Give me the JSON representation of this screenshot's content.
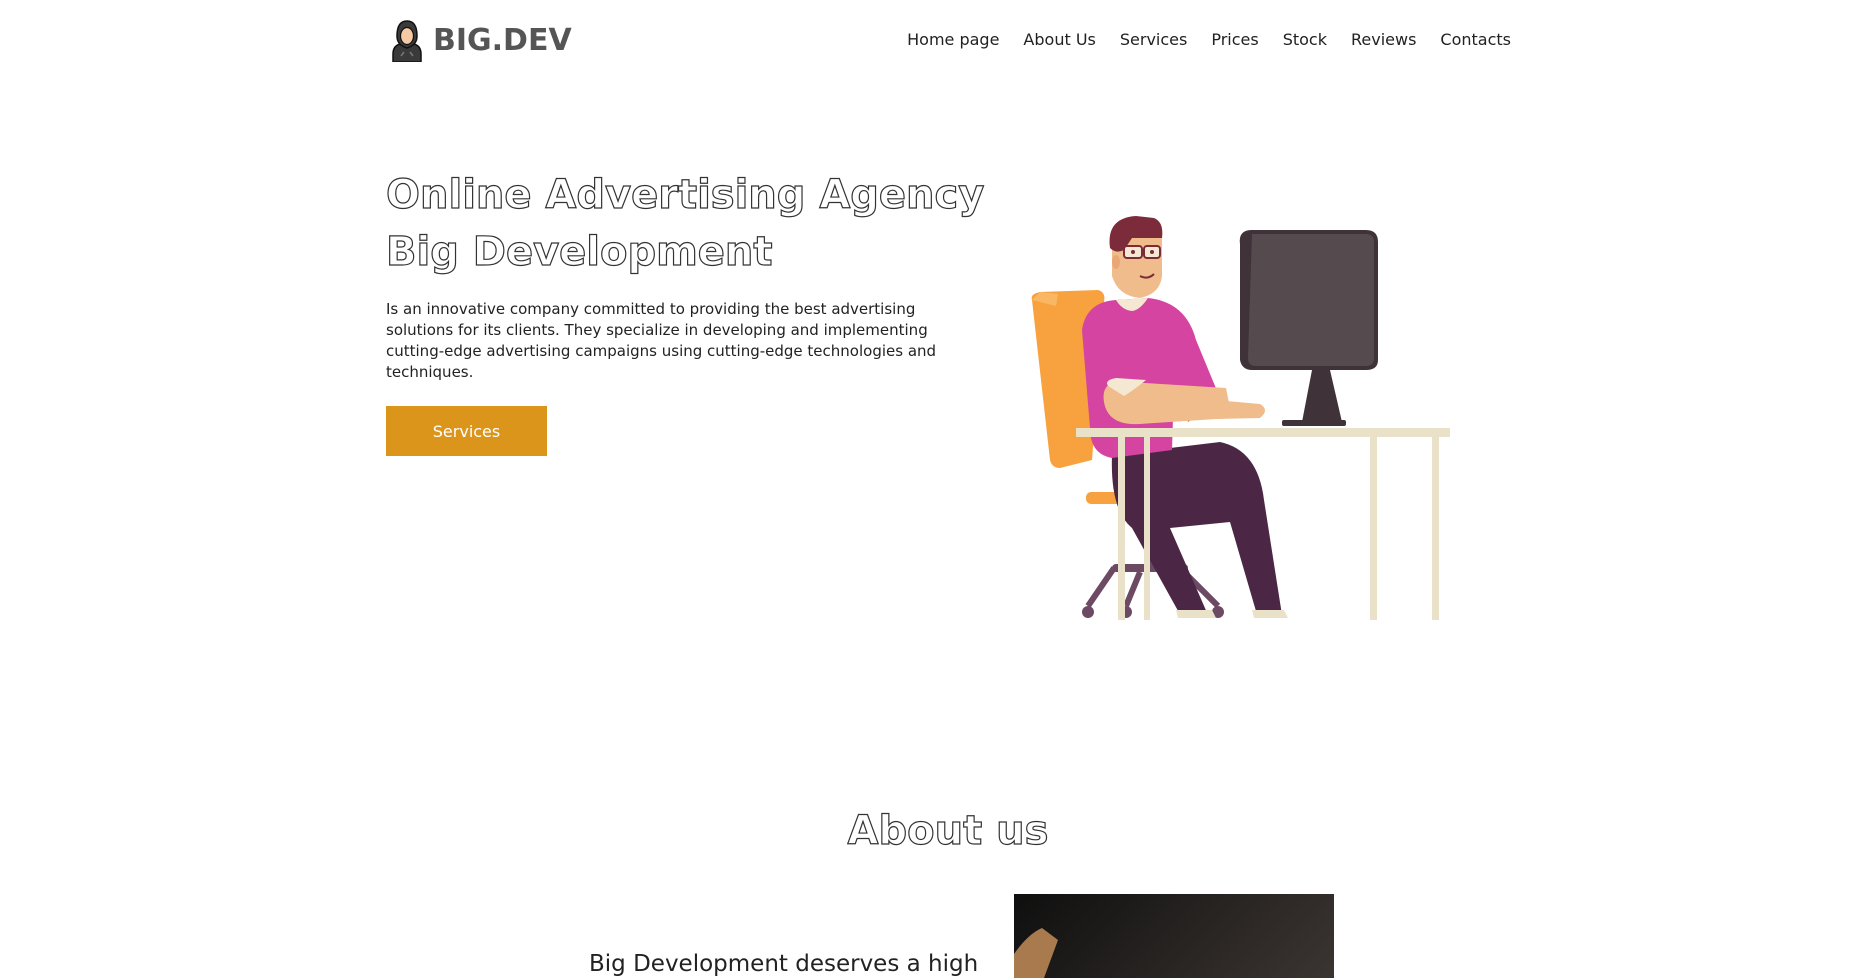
{
  "header": {
    "logo_text": "BIG.DEV",
    "logo_icon": "hooded-person-icon",
    "nav": [
      {
        "label": "Home page"
      },
      {
        "label": "About Us"
      },
      {
        "label": "Services"
      },
      {
        "label": "Prices"
      },
      {
        "label": "Stock"
      },
      {
        "label": "Reviews"
      },
      {
        "label": "Contacts"
      }
    ]
  },
  "hero": {
    "title_line1": "Online Advertising Agency",
    "title_line2": "Big Development",
    "description": "Is an innovative company committed to providing the best advertising solutions for its clients. They specialize in developing and implementing cutting-edge advertising campaigns using cutting-edge technologies and techniques.",
    "button_label": "Services",
    "illustration": "man-at-computer-illustration"
  },
  "about": {
    "title": "About us",
    "text_start": "Big Development deserves a high",
    "image": "about-photo"
  },
  "colors": {
    "accent": "#dc951b",
    "text": "#222222",
    "logo_text": "#555555",
    "background": "#ffffff"
  }
}
